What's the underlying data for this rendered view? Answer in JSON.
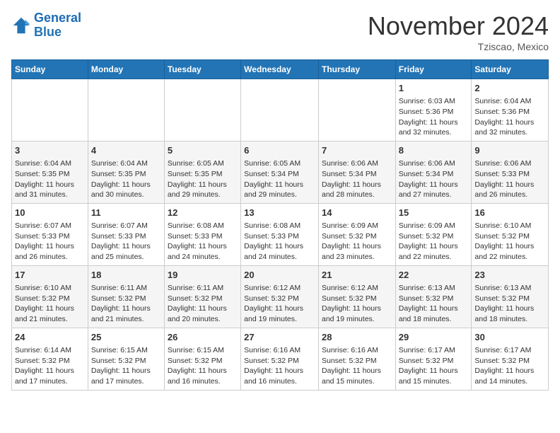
{
  "header": {
    "logo_line1": "General",
    "logo_line2": "Blue",
    "month": "November 2024",
    "location": "Tziscao, Mexico"
  },
  "days_of_week": [
    "Sunday",
    "Monday",
    "Tuesday",
    "Wednesday",
    "Thursday",
    "Friday",
    "Saturday"
  ],
  "weeks": [
    [
      {
        "day": "",
        "info": ""
      },
      {
        "day": "",
        "info": ""
      },
      {
        "day": "",
        "info": ""
      },
      {
        "day": "",
        "info": ""
      },
      {
        "day": "",
        "info": ""
      },
      {
        "day": "1",
        "info": "Sunrise: 6:03 AM\nSunset: 5:36 PM\nDaylight: 11 hours and 32 minutes."
      },
      {
        "day": "2",
        "info": "Sunrise: 6:04 AM\nSunset: 5:36 PM\nDaylight: 11 hours and 32 minutes."
      }
    ],
    [
      {
        "day": "3",
        "info": "Sunrise: 6:04 AM\nSunset: 5:35 PM\nDaylight: 11 hours and 31 minutes."
      },
      {
        "day": "4",
        "info": "Sunrise: 6:04 AM\nSunset: 5:35 PM\nDaylight: 11 hours and 30 minutes."
      },
      {
        "day": "5",
        "info": "Sunrise: 6:05 AM\nSunset: 5:35 PM\nDaylight: 11 hours and 29 minutes."
      },
      {
        "day": "6",
        "info": "Sunrise: 6:05 AM\nSunset: 5:34 PM\nDaylight: 11 hours and 29 minutes."
      },
      {
        "day": "7",
        "info": "Sunrise: 6:06 AM\nSunset: 5:34 PM\nDaylight: 11 hours and 28 minutes."
      },
      {
        "day": "8",
        "info": "Sunrise: 6:06 AM\nSunset: 5:34 PM\nDaylight: 11 hours and 27 minutes."
      },
      {
        "day": "9",
        "info": "Sunrise: 6:06 AM\nSunset: 5:33 PM\nDaylight: 11 hours and 26 minutes."
      }
    ],
    [
      {
        "day": "10",
        "info": "Sunrise: 6:07 AM\nSunset: 5:33 PM\nDaylight: 11 hours and 26 minutes."
      },
      {
        "day": "11",
        "info": "Sunrise: 6:07 AM\nSunset: 5:33 PM\nDaylight: 11 hours and 25 minutes."
      },
      {
        "day": "12",
        "info": "Sunrise: 6:08 AM\nSunset: 5:33 PM\nDaylight: 11 hours and 24 minutes."
      },
      {
        "day": "13",
        "info": "Sunrise: 6:08 AM\nSunset: 5:33 PM\nDaylight: 11 hours and 24 minutes."
      },
      {
        "day": "14",
        "info": "Sunrise: 6:09 AM\nSunset: 5:32 PM\nDaylight: 11 hours and 23 minutes."
      },
      {
        "day": "15",
        "info": "Sunrise: 6:09 AM\nSunset: 5:32 PM\nDaylight: 11 hours and 22 minutes."
      },
      {
        "day": "16",
        "info": "Sunrise: 6:10 AM\nSunset: 5:32 PM\nDaylight: 11 hours and 22 minutes."
      }
    ],
    [
      {
        "day": "17",
        "info": "Sunrise: 6:10 AM\nSunset: 5:32 PM\nDaylight: 11 hours and 21 minutes."
      },
      {
        "day": "18",
        "info": "Sunrise: 6:11 AM\nSunset: 5:32 PM\nDaylight: 11 hours and 21 minutes."
      },
      {
        "day": "19",
        "info": "Sunrise: 6:11 AM\nSunset: 5:32 PM\nDaylight: 11 hours and 20 minutes."
      },
      {
        "day": "20",
        "info": "Sunrise: 6:12 AM\nSunset: 5:32 PM\nDaylight: 11 hours and 19 minutes."
      },
      {
        "day": "21",
        "info": "Sunrise: 6:12 AM\nSunset: 5:32 PM\nDaylight: 11 hours and 19 minutes."
      },
      {
        "day": "22",
        "info": "Sunrise: 6:13 AM\nSunset: 5:32 PM\nDaylight: 11 hours and 18 minutes."
      },
      {
        "day": "23",
        "info": "Sunrise: 6:13 AM\nSunset: 5:32 PM\nDaylight: 11 hours and 18 minutes."
      }
    ],
    [
      {
        "day": "24",
        "info": "Sunrise: 6:14 AM\nSunset: 5:32 PM\nDaylight: 11 hours and 17 minutes."
      },
      {
        "day": "25",
        "info": "Sunrise: 6:15 AM\nSunset: 5:32 PM\nDaylight: 11 hours and 17 minutes."
      },
      {
        "day": "26",
        "info": "Sunrise: 6:15 AM\nSunset: 5:32 PM\nDaylight: 11 hours and 16 minutes."
      },
      {
        "day": "27",
        "info": "Sunrise: 6:16 AM\nSunset: 5:32 PM\nDaylight: 11 hours and 16 minutes."
      },
      {
        "day": "28",
        "info": "Sunrise: 6:16 AM\nSunset: 5:32 PM\nDaylight: 11 hours and 15 minutes."
      },
      {
        "day": "29",
        "info": "Sunrise: 6:17 AM\nSunset: 5:32 PM\nDaylight: 11 hours and 15 minutes."
      },
      {
        "day": "30",
        "info": "Sunrise: 6:17 AM\nSunset: 5:32 PM\nDaylight: 11 hours and 14 minutes."
      }
    ]
  ]
}
